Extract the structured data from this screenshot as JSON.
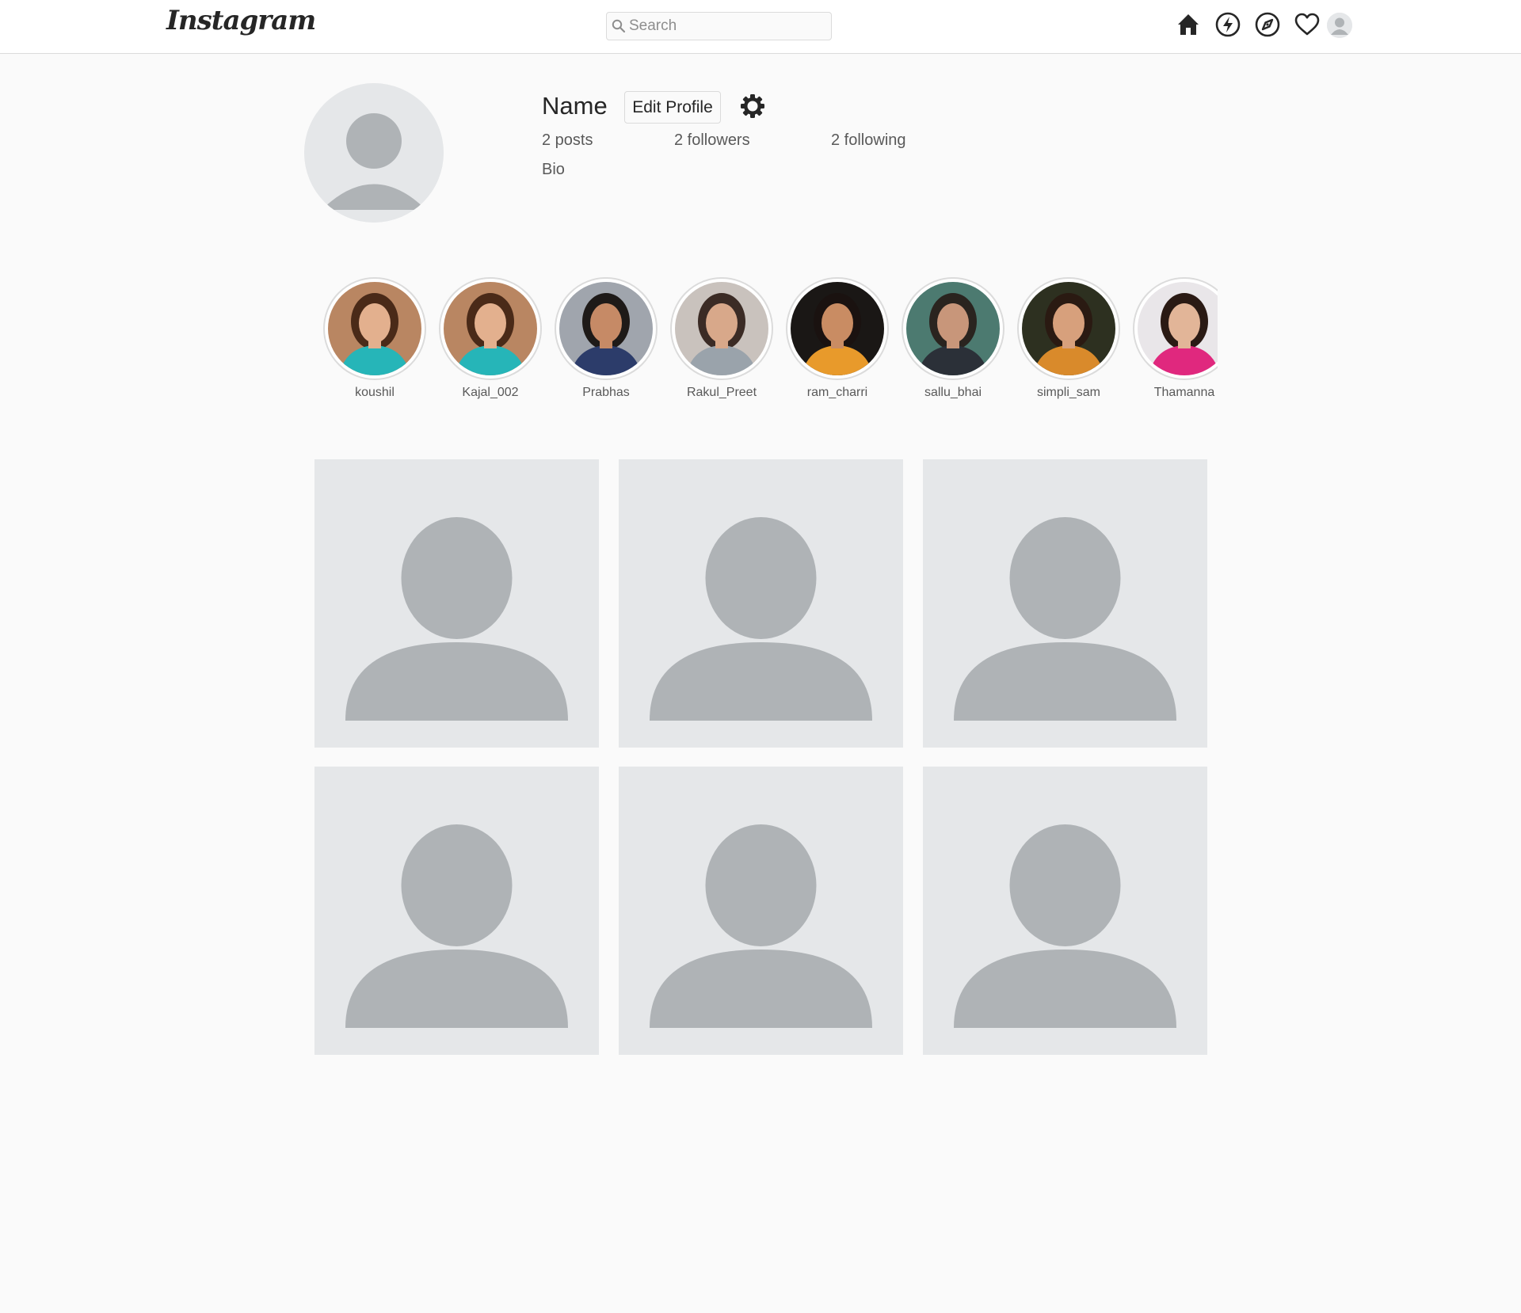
{
  "header": {
    "logo_text": "Instagram",
    "search": {
      "placeholder": "Search"
    },
    "icons": [
      "home-icon",
      "activity-icon",
      "explore-icon",
      "heart-icon",
      "avatar"
    ]
  },
  "profile": {
    "name": "Name",
    "edit_button": "Edit Profile",
    "posts": "2 posts",
    "followers": "2 followers",
    "following": "2 following",
    "bio": "Bio"
  },
  "stories": [
    {
      "label": "koushil",
      "colors": {
        "bg": "#b98662",
        "hair": "#4a2a18",
        "skin": "#e3b08e",
        "cloth": "#26b5b8"
      }
    },
    {
      "label": "Kajal_002",
      "colors": {
        "bg": "#b98662",
        "hair": "#4a2a18",
        "skin": "#e3b08e",
        "cloth": "#26b5b8"
      }
    },
    {
      "label": "Prabhas",
      "colors": {
        "bg": "#a0a5ad",
        "hair": "#1e1a18",
        "skin": "#c68a66",
        "cloth": "#2c3c6a"
      }
    },
    {
      "label": "Rakul_Preet",
      "colors": {
        "bg": "#c9c2bd",
        "hair": "#3b2b25",
        "skin": "#d8a88a",
        "cloth": "#9aa3ab"
      }
    },
    {
      "label": "ram_charri",
      "colors": {
        "bg": "#1a1715",
        "hair": "#1a1210",
        "skin": "#c98c63",
        "cloth": "#e89a2b"
      }
    },
    {
      "label": "sallu_bhai",
      "colors": {
        "bg": "#4c7a70",
        "hair": "#2a241f",
        "skin": "#c8967a",
        "cloth": "#2b3038"
      }
    },
    {
      "label": "simpli_sam",
      "colors": {
        "bg": "#2d3020",
        "hair": "#2a1a12",
        "skin": "#d7a07c",
        "cloth": "#d98a2b"
      }
    },
    {
      "label": "Thamanna",
      "colors": {
        "bg": "#e9e6e9",
        "hair": "#2a1a14",
        "skin": "#e2b598",
        "cloth": "#e0287e"
      }
    }
  ],
  "posts": [
    {
      "type": "placeholder-avatar"
    },
    {
      "type": "placeholder-avatar"
    },
    {
      "type": "placeholder-avatar"
    },
    {
      "type": "placeholder-avatar"
    },
    {
      "type": "placeholder-avatar"
    },
    {
      "type": "placeholder-avatar"
    }
  ],
  "colors": {
    "placeholder_bg": "#e5e7e9",
    "placeholder_fg": "#afb3b6"
  }
}
